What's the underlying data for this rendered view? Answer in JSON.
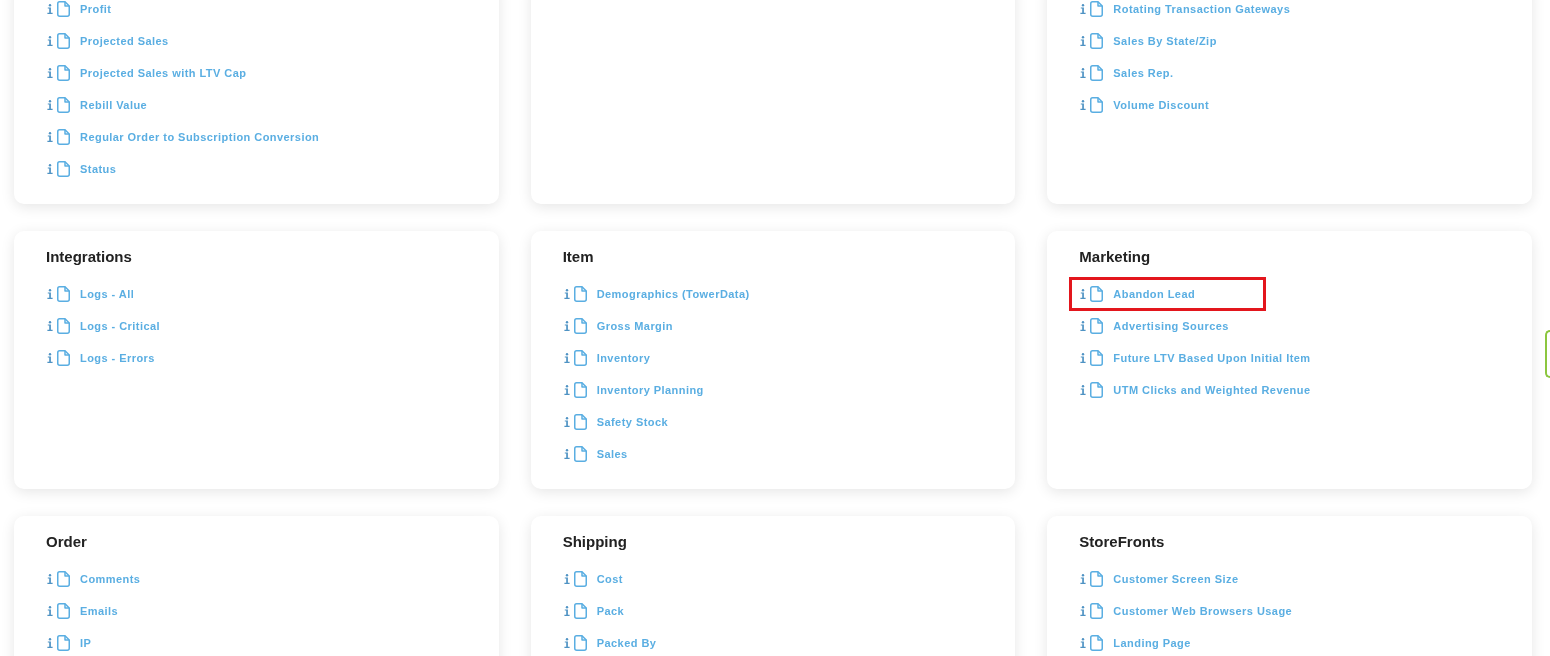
{
  "cards": [
    {
      "kind": "links",
      "items": [
        {
          "label": "Profit",
          "highlighted": false
        },
        {
          "label": "Projected Sales",
          "highlighted": false
        },
        {
          "label": "Projected Sales with LTV Cap",
          "highlighted": false
        },
        {
          "label": "Rebill Value",
          "highlighted": false
        },
        {
          "label": "Regular Order to Subscription Conversion",
          "highlighted": false
        },
        {
          "label": "Status",
          "highlighted": false
        }
      ]
    },
    {
      "kind": "blank"
    },
    {
      "kind": "links",
      "items": [
        {
          "label": "Rotating Transaction Gateways",
          "highlighted": false
        },
        {
          "label": "Sales By State/Zip",
          "highlighted": false
        },
        {
          "label": "Sales Rep.",
          "highlighted": false
        },
        {
          "label": "Volume Discount",
          "highlighted": false
        }
      ]
    },
    {
      "kind": "links",
      "title": "Integrations",
      "items": [
        {
          "label": "Logs - All",
          "highlighted": false
        },
        {
          "label": "Logs - Critical",
          "highlighted": false
        },
        {
          "label": "Logs - Errors",
          "highlighted": false
        }
      ]
    },
    {
      "kind": "links",
      "title": "Item",
      "items": [
        {
          "label": "Demographics (TowerData)",
          "highlighted": false
        },
        {
          "label": "Gross Margin",
          "highlighted": false
        },
        {
          "label": "Inventory",
          "highlighted": false
        },
        {
          "label": "Inventory Planning",
          "highlighted": false
        },
        {
          "label": "Safety Stock",
          "highlighted": false
        },
        {
          "label": "Sales",
          "highlighted": false
        }
      ]
    },
    {
      "kind": "links",
      "title": "Marketing",
      "items": [
        {
          "label": "Abandon Lead",
          "highlighted": true
        },
        {
          "label": "Advertising Sources",
          "highlighted": false
        },
        {
          "label": "Future LTV Based Upon Initial Item",
          "highlighted": false
        },
        {
          "label": "UTM Clicks and Weighted Revenue",
          "highlighted": false
        }
      ]
    },
    {
      "kind": "links",
      "title": "Order",
      "items": [
        {
          "label": "Comments",
          "highlighted": false
        },
        {
          "label": "Emails",
          "highlighted": false
        },
        {
          "label": "IP",
          "highlighted": false
        }
      ]
    },
    {
      "kind": "links",
      "title": "Shipping",
      "items": [
        {
          "label": "Cost",
          "highlighted": false
        },
        {
          "label": "Pack",
          "highlighted": false
        },
        {
          "label": "Packed By",
          "highlighted": false
        }
      ]
    },
    {
      "kind": "links",
      "title": "StoreFronts",
      "items": [
        {
          "label": "Customer Screen Size",
          "highlighted": false
        },
        {
          "label": "Customer Web Browsers Usage",
          "highlighted": false
        },
        {
          "label": "Landing Page",
          "highlighted": false
        }
      ]
    }
  ]
}
